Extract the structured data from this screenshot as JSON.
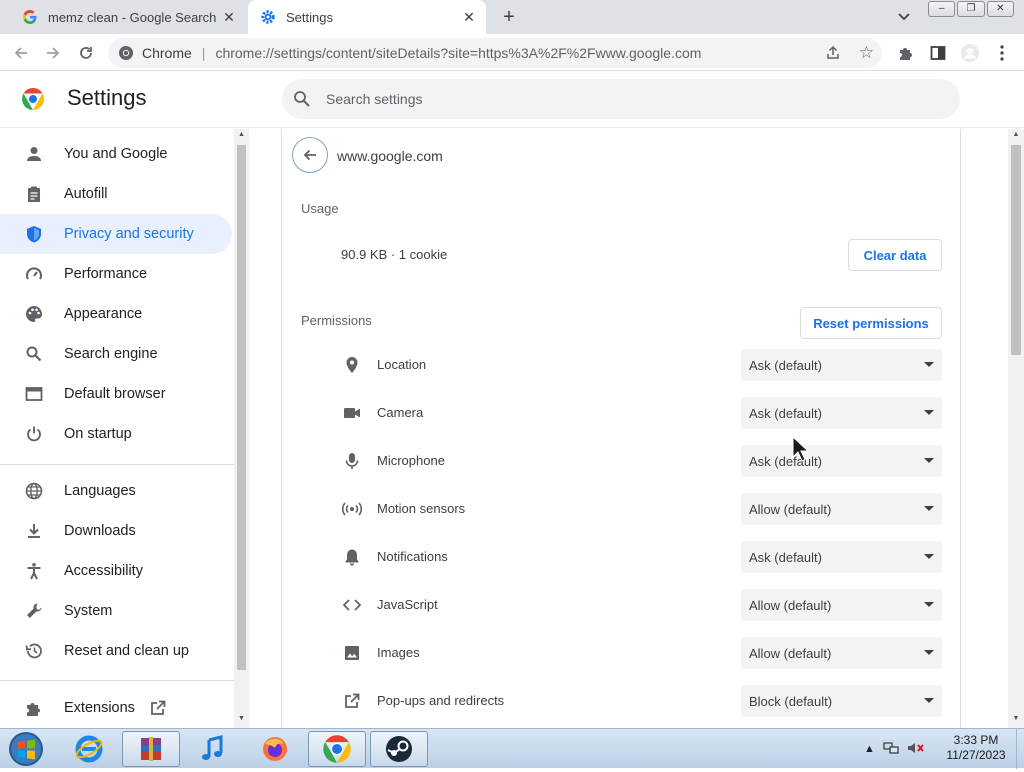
{
  "browser": {
    "tabs": [
      {
        "title": "memz clean - Google Search",
        "favicon": "google-g",
        "active": false
      },
      {
        "title": "Settings",
        "favicon": "settings-gear",
        "active": true
      }
    ],
    "omnibox": {
      "label": "Chrome",
      "url": "chrome://settings/content/siteDetails?site=https%3A%2F%2Fwww.google.com"
    }
  },
  "header": {
    "title": "Settings",
    "search_placeholder": "Search settings"
  },
  "sidebar": {
    "items": [
      {
        "label": "You and Google",
        "icon": "person-icon"
      },
      {
        "label": "Autofill",
        "icon": "clipboard-icon"
      },
      {
        "label": "Privacy and security",
        "icon": "shield-icon",
        "active": true
      },
      {
        "label": "Performance",
        "icon": "speedometer-icon"
      },
      {
        "label": "Appearance",
        "icon": "palette-icon"
      },
      {
        "label": "Search engine",
        "icon": "search-icon"
      },
      {
        "label": "Default browser",
        "icon": "browser-window-icon"
      },
      {
        "label": "On startup",
        "icon": "power-icon"
      },
      {
        "label": "Languages",
        "icon": "globe-icon"
      },
      {
        "label": "Downloads",
        "icon": "download-icon"
      },
      {
        "label": "Accessibility",
        "icon": "accessibility-icon"
      },
      {
        "label": "System",
        "icon": "wrench-icon"
      },
      {
        "label": "Reset and clean up",
        "icon": "history-icon"
      },
      {
        "label": "Extensions",
        "icon": "puzzle-icon"
      }
    ]
  },
  "site": {
    "name": "www.google.com",
    "usage_header": "Usage",
    "usage_value": "90.9 KB · 1 cookie",
    "clear_label": "Clear data",
    "permissions_header": "Permissions",
    "reset_label": "Reset permissions",
    "permissions": [
      {
        "label": "Location",
        "value": "Ask (default)",
        "icon": "location-pin-icon"
      },
      {
        "label": "Camera",
        "value": "Ask (default)",
        "icon": "camera-icon"
      },
      {
        "label": "Microphone",
        "value": "Ask (default)",
        "icon": "microphone-icon"
      },
      {
        "label": "Motion sensors",
        "value": "Allow (default)",
        "icon": "sensors-icon"
      },
      {
        "label": "Notifications",
        "value": "Ask (default)",
        "icon": "bell-icon"
      },
      {
        "label": "JavaScript",
        "value": "Allow (default)",
        "icon": "code-icon"
      },
      {
        "label": "Images",
        "value": "Allow (default)",
        "icon": "image-icon"
      },
      {
        "label": "Pop-ups and redirects",
        "value": "Block (default)",
        "icon": "open-in-new-icon"
      }
    ]
  },
  "taskbar": {
    "apps": [
      "internet-explorer-icon",
      "winrar-icon",
      "itunes-icon",
      "firefox-icon",
      "chrome-icon",
      "steam-icon"
    ],
    "time": "3:33 PM",
    "date": "11/27/2023"
  },
  "colors": {
    "accent": "#1a73e8",
    "active_bg": "#e8f0fe",
    "tabstrip": "#dee1e6"
  }
}
